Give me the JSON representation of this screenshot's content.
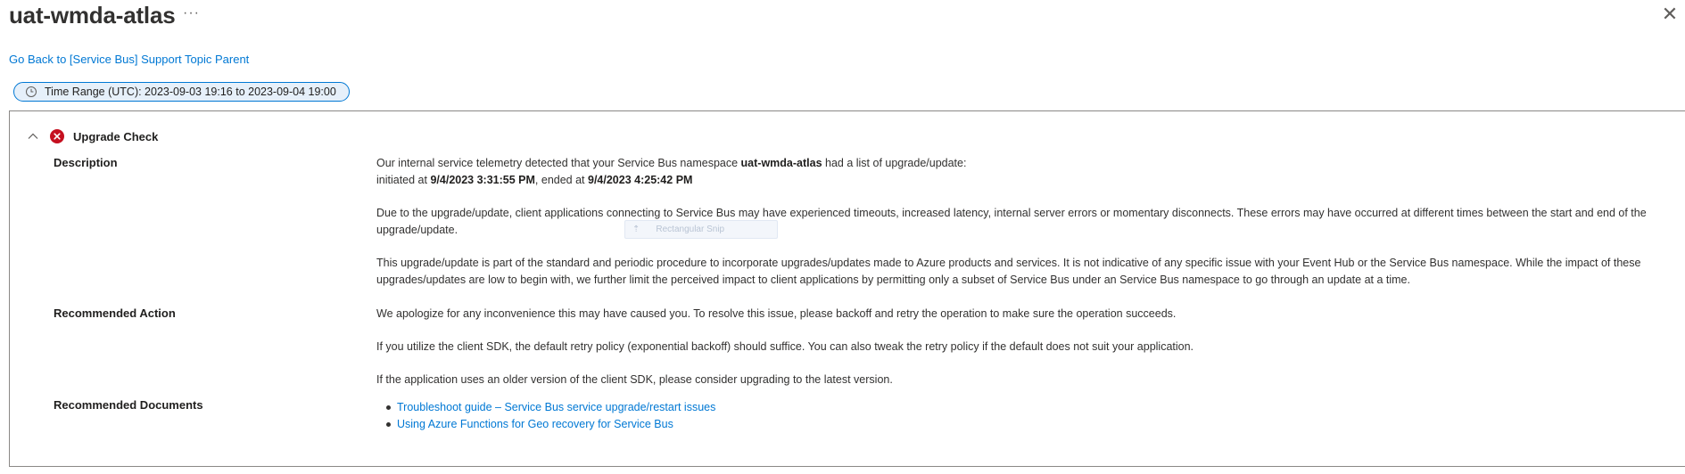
{
  "header": {
    "title": "uat-wmda-atlas",
    "more_label": "···",
    "close_label": "✕"
  },
  "nav": {
    "back_link": "Go Back to [Service Bus] Support Topic Parent"
  },
  "time_range": {
    "label": "Time Range (UTC): 2023-09-03 19:16 to 2023-09-04 19:00"
  },
  "check": {
    "title": "Upgrade Check",
    "status": "error",
    "description_label": "Description",
    "description": {
      "line1_prefix": "Our internal service telemetry detected that your Service Bus namespace ",
      "namespace": "uat-wmda-atlas",
      "line1_suffix": " had a list of upgrade/update:",
      "line2_prefix": "initiated at ",
      "start": "9/4/2023 3:31:55 PM",
      "line2_mid": ", ended at ",
      "end": "9/4/2023 4:25:42 PM",
      "para2": "Due to the upgrade/update, client applications connecting to Service Bus may have experienced timeouts, increased latency, internal server errors or momentary disconnects. These errors may have occurred at different times between the start and end of the upgrade/update.",
      "para3": "This upgrade/update is part of the standard and periodic procedure to incorporate upgrades/updates made to Azure products and services. It is not indicative of any specific issue with your Event Hub or the Service Bus namespace. While the impact of these upgrades/updates are low to begin with, we further limit the perceived impact to client applications by permitting only a subset of Service Bus under an Service Bus namespace to go through an update at a time."
    },
    "action_label": "Recommended Action",
    "action": {
      "para1": "We apologize for any inconvenience this may have caused you. To resolve this issue, please backoff and retry the operation to make sure the operation succeeds.",
      "para2": "If you utilize the client SDK, the default retry policy (exponential backoff) should suffice. You can also tweak the retry policy if the default does not suit your application.",
      "para3": "If the application uses an older version of the client SDK, please consider upgrading to the latest version."
    },
    "docs_label": "Recommended Documents",
    "docs": [
      "Troubleshoot guide – Service Bus service upgrade/restart issues",
      "Using Azure Functions for Geo recovery for Service Bus"
    ]
  },
  "overlay": {
    "snip_label": "Rectangular Snip"
  },
  "colors": {
    "link": "#0078d4",
    "error": "#c50f1f",
    "pill_bg": "#e6f0fa"
  }
}
